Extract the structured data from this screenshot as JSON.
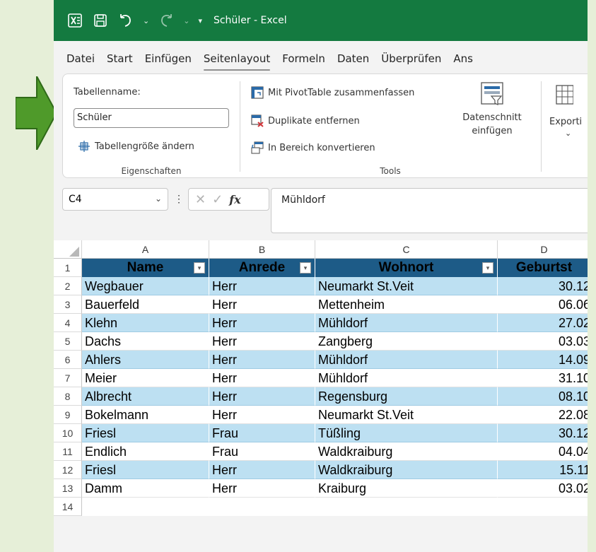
{
  "titlebar": {
    "title": "Schüler - Excel",
    "app_icon": "excel-icon",
    "save_icon": "save-icon",
    "undo_icon": "undo-icon",
    "redo_icon": "redo-icon",
    "customize_icon": "customize-toolbar-icon"
  },
  "menu": {
    "items": [
      "Datei",
      "Start",
      "Einfügen",
      "Seitenlayout",
      "Formeln",
      "Daten",
      "Überprüfen",
      "Ans"
    ],
    "active": "Seitenlayout"
  },
  "ribbon": {
    "properties": {
      "table_name_label": "Tabellenname:",
      "table_name_value": "Schüler",
      "resize_label": "Tabellengröße ändern",
      "group_label": "Eigenschaften"
    },
    "tools": {
      "pivot_label": "Mit PivotTable zusammenfassen",
      "duplicates_label": "Duplikate entfernen",
      "convert_label": "In Bereich konvertieren",
      "slicer_label_1": "Datenschnitt",
      "slicer_label_2": "einfügen",
      "group_label": "Tools"
    },
    "external": {
      "export_label": "Exporti"
    }
  },
  "formula_bar": {
    "cell_ref": "C4",
    "value": "Mühldorf",
    "fx_label": "fx"
  },
  "grid": {
    "columns": [
      "A",
      "B",
      "C",
      "D"
    ],
    "header_row": [
      "Name",
      "Anrede",
      "Wohnort",
      "Geburtst"
    ],
    "rows": [
      {
        "num": "2",
        "name": "Wegbauer",
        "anrede": "Herr",
        "wohnort": "Neumarkt St.Veit",
        "geb": "30.12"
      },
      {
        "num": "3",
        "name": "Bauerfeld",
        "anrede": "Herr",
        "wohnort": "Mettenheim",
        "geb": "06.06"
      },
      {
        "num": "4",
        "name": "Klehn",
        "anrede": "Herr",
        "wohnort": "Mühldorf",
        "geb": "27.02"
      },
      {
        "num": "5",
        "name": "Dachs",
        "anrede": "Herr",
        "wohnort": "Zangberg",
        "geb": "03.03"
      },
      {
        "num": "6",
        "name": "Ahlers",
        "anrede": "Herr",
        "wohnort": "Mühldorf",
        "geb": "14.09"
      },
      {
        "num": "7",
        "name": "Meier",
        "anrede": "Herr",
        "wohnort": "Mühldorf",
        "geb": "31.10"
      },
      {
        "num": "8",
        "name": "Albrecht",
        "anrede": "Herr",
        "wohnort": "Regensburg",
        "geb": "08.10"
      },
      {
        "num": "9",
        "name": "Bokelmann",
        "anrede": "Herr",
        "wohnort": "Neumarkt St.Veit",
        "geb": "22.08"
      },
      {
        "num": "10",
        "name": "Friesl",
        "anrede": "Frau",
        "wohnort": "Tüßling",
        "geb": "30.12"
      },
      {
        "num": "11",
        "name": "Endlich",
        "anrede": "Frau",
        "wohnort": "Waldkraiburg",
        "geb": "04.04"
      },
      {
        "num": "12",
        "name": "Friesl",
        "anrede": "Herr",
        "wohnort": "Waldkraiburg",
        "geb": "15.11"
      },
      {
        "num": "13",
        "name": "Damm",
        "anrede": "Herr",
        "wohnort": "Kraiburg",
        "geb": "03.02"
      }
    ],
    "header_row_num": "1",
    "last_row_num": "14"
  },
  "colors": {
    "title_green": "#147a40",
    "header_blue": "#1d5b87",
    "band_blue": "#bde0f2",
    "arrow_green": "#4f9a2a",
    "background": "#e6efd8"
  }
}
